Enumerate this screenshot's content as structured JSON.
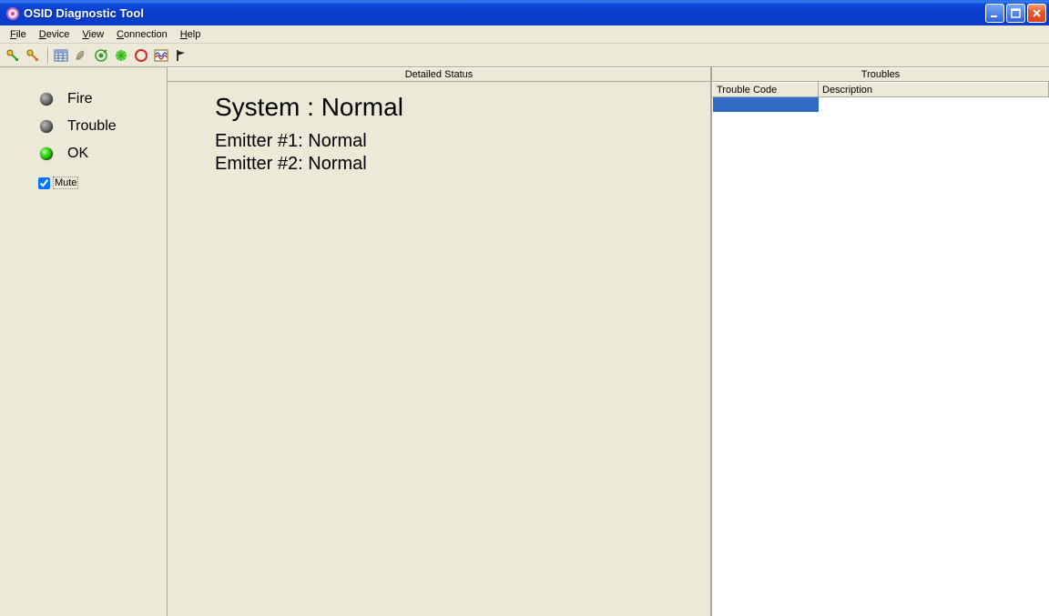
{
  "window": {
    "title": "OSID Diagnostic Tool"
  },
  "menu": {
    "file": "File",
    "device": "Device",
    "view": "View",
    "connection": "Connection",
    "help": "Help"
  },
  "sidebar": {
    "fire": "Fire",
    "trouble": "Trouble",
    "ok": "OK",
    "mute_label": "Mute",
    "mute_checked": true
  },
  "panels": {
    "detailed_status_header": "Detailed Status",
    "troubles_header": "Troubles"
  },
  "detail": {
    "system_line": "System : Normal",
    "emitter1_line": "Emitter #1: Normal",
    "emitter2_line": "Emitter #2: Normal"
  },
  "troubles_table": {
    "col_code": "Trouble Code",
    "col_desc": "Description",
    "rows": [
      {
        "code": "",
        "desc": ""
      }
    ]
  },
  "icons": {
    "app": "app-icon",
    "connect_green": "connect-green-icon",
    "connect_orange": "connect-orange-icon",
    "grid": "grid-icon",
    "leaf": "leaf-icon",
    "target": "target-icon",
    "star_green": "star-green-icon",
    "circle_red": "circle-red-icon",
    "wave": "wave-icon",
    "flag": "flag-icon"
  }
}
